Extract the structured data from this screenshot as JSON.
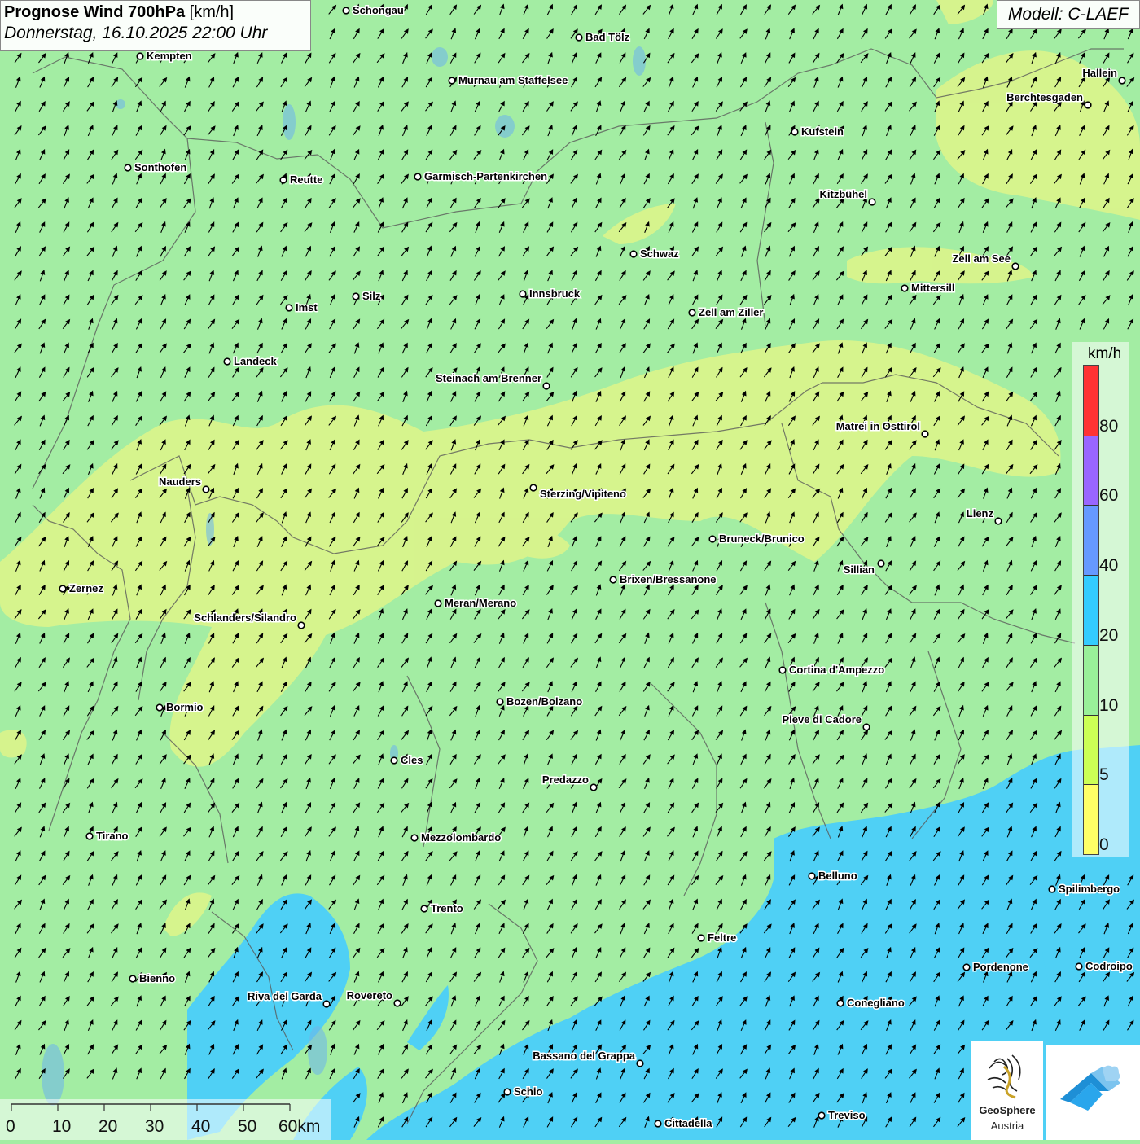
{
  "header": {
    "title_bold": "Prognose Wind 700hPa",
    "title_unit": "[km/h]",
    "subtitle": "Donnerstag, 16.10.2025 22:00 Uhr"
  },
  "model_label": "Modell: C-LAEF",
  "legend": {
    "unit": "km/h",
    "bands": [
      {
        "from": 0,
        "to": 5,
        "color": "#ffff66"
      },
      {
        "from": 5,
        "to": 10,
        "color": "#ccff55"
      },
      {
        "from": 10,
        "to": 20,
        "color": "#99f099"
      },
      {
        "from": 20,
        "to": 40,
        "color": "#33ccff"
      },
      {
        "from": 40,
        "to": 60,
        "color": "#6699ff"
      },
      {
        "from": 60,
        "to": 80,
        "color": "#9966ff"
      },
      {
        "from": 80,
        "to": 100,
        "color": "#ff3333"
      }
    ],
    "ticks": [
      "0",
      "5",
      "10",
      "20",
      "40",
      "60",
      "80"
    ]
  },
  "scale_bar": {
    "labels": [
      "0",
      "10",
      "20",
      "30",
      "40",
      "50",
      "60km"
    ]
  },
  "logo": {
    "name": "GeoSphere",
    "sub": "Austria"
  },
  "app_icon": "geosphere-warn-app-icon",
  "wind_direction": "NE",
  "colors": {
    "field_default": "#a3eda3",
    "field_calm": "#dff58a",
    "field_strong": "#4fd0f5",
    "arrow": "#000000",
    "border": "#5a5a5a"
  },
  "cities": [
    {
      "name": "Schongau"
    },
    {
      "name": "Bad Tölz"
    },
    {
      "name": "Kempten"
    },
    {
      "name": "Murnau am Staffelsee"
    },
    {
      "name": "Hallein"
    },
    {
      "name": "Berchtesgaden"
    },
    {
      "name": "Kufstein"
    },
    {
      "name": "Sonthofen"
    },
    {
      "name": "Reutte"
    },
    {
      "name": "Garmisch-Partenkirchen"
    },
    {
      "name": "Kitzbühel"
    },
    {
      "name": "Schwaz"
    },
    {
      "name": "Zell am See"
    },
    {
      "name": "Mittersill"
    },
    {
      "name": "Innsbruck"
    },
    {
      "name": "Silz"
    },
    {
      "name": "Imst"
    },
    {
      "name": "Zell am Ziller"
    },
    {
      "name": "Landeck"
    },
    {
      "name": "Steinach am Brenner"
    },
    {
      "name": "Matrei in Osttirol"
    },
    {
      "name": "Nauders"
    },
    {
      "name": "Sterzing/Vipiteno"
    },
    {
      "name": "Lienz"
    },
    {
      "name": "Bruneck/Brunico"
    },
    {
      "name": "Sillian"
    },
    {
      "name": "Brixen/Bressanone"
    },
    {
      "name": "Zernez"
    },
    {
      "name": "Meran/Merano"
    },
    {
      "name": "Schlanders/Silandro"
    },
    {
      "name": "Cortina d'Ampezzo"
    },
    {
      "name": "Bozen/Bolzano"
    },
    {
      "name": "Bormio"
    },
    {
      "name": "Pieve di Cadore"
    },
    {
      "name": "Cles"
    },
    {
      "name": "Predazzo"
    },
    {
      "name": "Tirano"
    },
    {
      "name": "Mezzolombardo"
    },
    {
      "name": "Belluno"
    },
    {
      "name": "Spilimbergo"
    },
    {
      "name": "Trento"
    },
    {
      "name": "Feltre"
    },
    {
      "name": "Pordenone"
    },
    {
      "name": "Codroipo"
    },
    {
      "name": "Bienno"
    },
    {
      "name": "Riva del Garda"
    },
    {
      "name": "Rovereto"
    },
    {
      "name": "Conegliano"
    },
    {
      "name": "Bassano del Grappa"
    },
    {
      "name": "Schio"
    },
    {
      "name": "Treviso"
    },
    {
      "name": "Cittadella"
    }
  ]
}
